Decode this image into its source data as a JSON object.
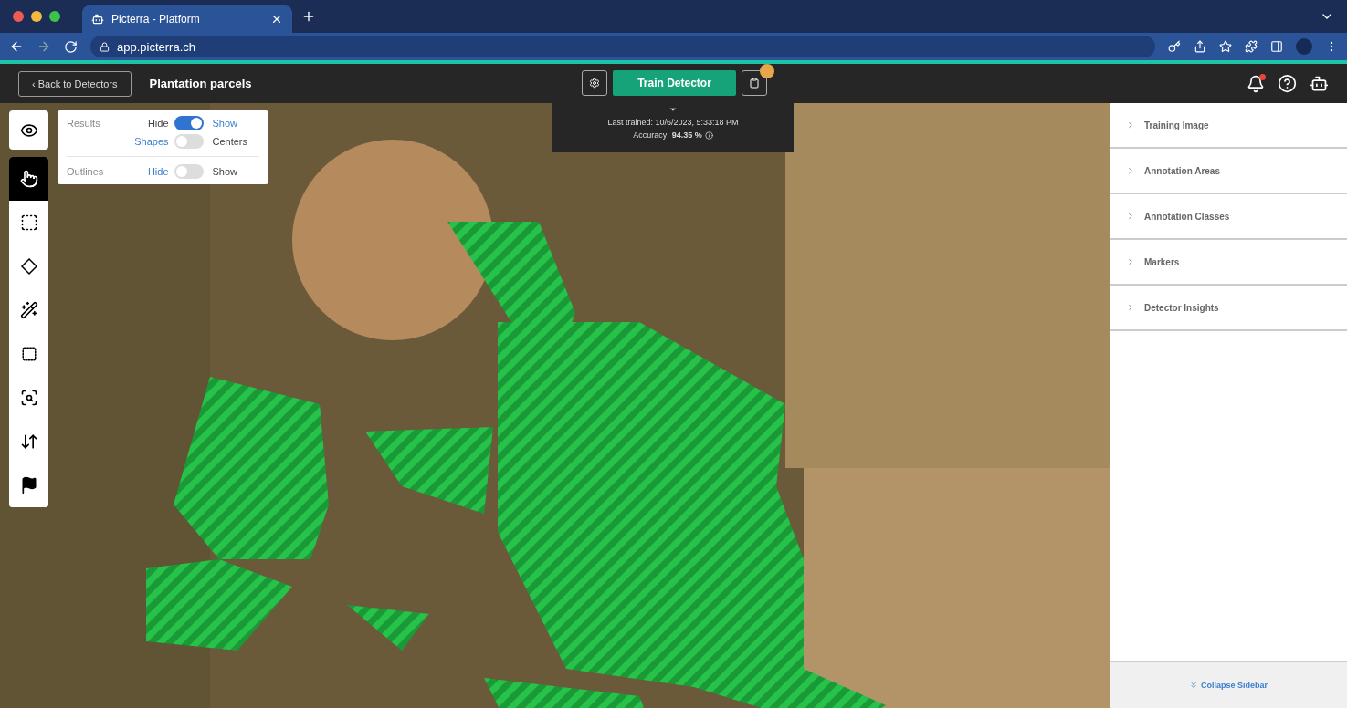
{
  "browser": {
    "tab_title": "Picterra - Platform",
    "url": "app.picterra.ch"
  },
  "header": {
    "back_button": "‹ Back to Detectors",
    "title": "Plantation parcels",
    "train_button": "Train Detector",
    "notification_dot": true,
    "has_update_badge": true
  },
  "training_info": {
    "last_trained": "Last trained: 10/6/2023, 5:33:18 PM",
    "accuracy_label": "Accuracy:",
    "accuracy_value": "94.35 %"
  },
  "view_panel": {
    "rows": [
      {
        "label": "Results",
        "off_label": "Hide",
        "on_label": "Show",
        "on": true
      },
      {
        "label": "",
        "off_label": "Shapes",
        "on_label": "Centers",
        "on": false
      },
      {
        "label": "Outlines",
        "off_label": "Hide",
        "on_label": "Show",
        "on": false
      }
    ]
  },
  "tools": [
    {
      "kind": "pointer",
      "selected": true
    },
    {
      "kind": "rect",
      "selected": false
    },
    {
      "kind": "polygon",
      "selected": false
    },
    {
      "kind": "wand",
      "selected": false
    },
    {
      "kind": "frame",
      "selected": false
    },
    {
      "kind": "zoom",
      "selected": false
    },
    {
      "kind": "sort",
      "selected": false
    },
    {
      "kind": "flag",
      "selected": false
    }
  ],
  "sidebar": {
    "sections": [
      {
        "title": "Training Image",
        "expanded": false
      },
      {
        "title": "Annotation Areas",
        "expanded": false
      },
      {
        "title": "Annotation Classes",
        "expanded": false
      },
      {
        "title": "Markers",
        "expanded": false
      },
      {
        "title": "Detector Insights",
        "expanded": false
      }
    ],
    "collapse_label": "Collapse Sidebar"
  }
}
